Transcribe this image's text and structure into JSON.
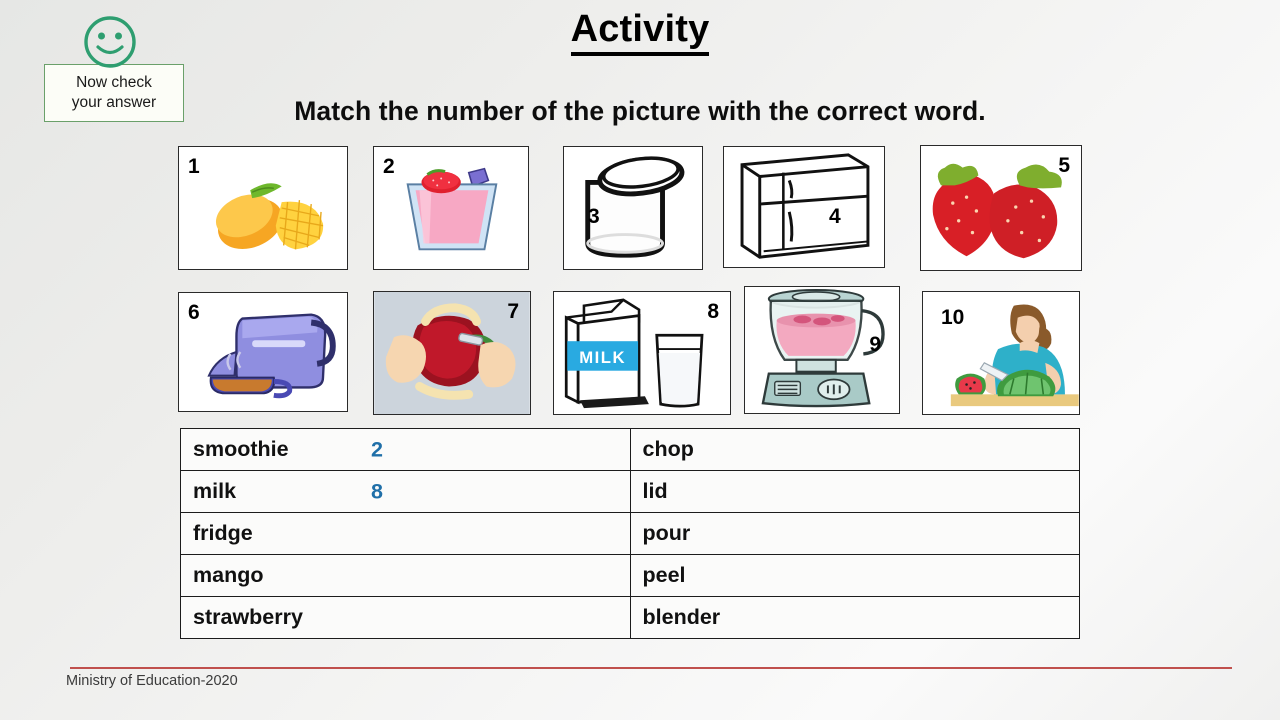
{
  "check_widget": {
    "icon": "smiley-face-icon",
    "line1": "Now check",
    "line2": "your answer",
    "border_color": "#6aa06a",
    "icon_color": "#2e9e70"
  },
  "header": {
    "title": "Activity",
    "instruction": "Match the number of the picture with the correct word."
  },
  "pictures": [
    {
      "number": "1",
      "name": "mango-image",
      "caption_word": "mango"
    },
    {
      "number": "2",
      "name": "smoothie-image",
      "caption_word": "smoothie"
    },
    {
      "number": "3",
      "name": "jar-with-lid-image",
      "caption_word": "lid"
    },
    {
      "number": "4",
      "name": "fridge-image",
      "caption_word": "fridge"
    },
    {
      "number": "5",
      "name": "strawberries-image",
      "caption_word": "strawberry"
    },
    {
      "number": "6",
      "name": "pouring-kettle-image",
      "caption_word": "pour"
    },
    {
      "number": "7",
      "name": "peeling-apple-image",
      "caption_word": "peel"
    },
    {
      "number": "8",
      "name": "milk-carton-image",
      "caption_word": "milk",
      "label": "MILK"
    },
    {
      "number": "9",
      "name": "blender-image",
      "caption_word": "blender"
    },
    {
      "number": "10",
      "name": "chopping-watermelon-image",
      "caption_word": "chop"
    }
  ],
  "answer_table": {
    "answer_color": "#1f6fa8",
    "rows": [
      {
        "left_word": "smoothie",
        "left_answer": "2",
        "right_word": "chop",
        "right_answer": ""
      },
      {
        "left_word": "milk",
        "left_answer": "8",
        "right_word": "lid",
        "right_answer": ""
      },
      {
        "left_word": "fridge",
        "left_answer": "",
        "right_word": "pour",
        "right_answer": ""
      },
      {
        "left_word": "mango",
        "left_answer": "",
        "right_word": "peel",
        "right_answer": ""
      },
      {
        "left_word": "strawberry",
        "left_answer": "",
        "right_word": "blender",
        "right_answer": ""
      }
    ]
  },
  "footer": {
    "text": "Ministry of Education-2020",
    "rule_color": "#c0504d"
  }
}
